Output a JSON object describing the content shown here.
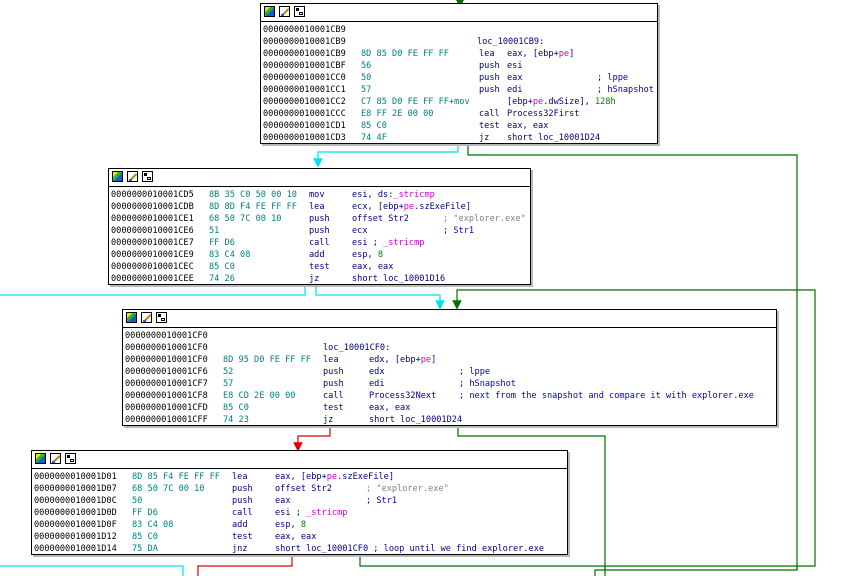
{
  "colors": {
    "flow_normal": "#00e0f0",
    "flow_taken": "#007000",
    "flow_not_taken": "#e00000",
    "address": "#000000",
    "bytes": "#008080",
    "instruction": "#000080",
    "symbol": "#d000d0",
    "string": "#808080",
    "number": "#008000"
  },
  "blocks": [
    {
      "id": "block-10001CB9",
      "header_icons": [
        "node-color-icon",
        "rename-node-icon",
        "graph-overview-icon"
      ],
      "lines": [
        {
          "addr": "0000000010001CB9"
        },
        {
          "addr": "0000000010001CB9",
          "label": "loc_10001CB9:"
        },
        {
          "addr": "0000000010001CB9",
          "bytes": "8D 85 D0 FE FF FF",
          "mnem": "lea",
          "ops": [
            {
              "t": "eax, [ebp+"
            },
            {
              "t": "pe",
              "k": "sym"
            },
            {
              "t": "]"
            }
          ]
        },
        {
          "addr": "0000000010001CBF",
          "bytes": "56",
          "mnem": "push",
          "ops": [
            {
              "t": "esi"
            }
          ]
        },
        {
          "addr": "0000000010001CC0",
          "bytes": "50",
          "mnem": "push",
          "ops": [
            {
              "t": "eax"
            }
          ],
          "comment": "; lppe"
        },
        {
          "addr": "0000000010001CC1",
          "bytes": "57",
          "mnem": "push",
          "ops": [
            {
              "t": "edi"
            }
          ],
          "comment": "; hSnapshot"
        },
        {
          "addr": "0000000010001CC2",
          "bytes": "C7 85 D0 FE FF FF+mov",
          "mnem": "",
          "ops": [
            {
              "t": "[ebp+"
            },
            {
              "t": "pe",
              "k": "sym"
            },
            {
              "t": ".dwSize], "
            },
            {
              "t": "128h",
              "k": "num"
            }
          ]
        },
        {
          "addr": "0000000010001CCC",
          "bytes": "E8 FF 2E 00 00",
          "mnem": "call",
          "ops": [
            {
              "t": "Process32First"
            }
          ]
        },
        {
          "addr": "0000000010001CD1",
          "bytes": "85 C0",
          "mnem": "test",
          "ops": [
            {
              "t": "eax, eax"
            }
          ]
        },
        {
          "addr": "0000000010001CD3",
          "bytes": "74 4F",
          "mnem": "jz",
          "ops": [
            {
              "t": "short loc_10001D24"
            }
          ]
        }
      ]
    },
    {
      "id": "block-10001CD5",
      "header_icons": [
        "node-color-icon",
        "rename-node-icon",
        "graph-overview-icon"
      ],
      "lines": [
        {
          "addr": "0000000010001CD5",
          "bytes": "8B 35 C0 50 00 10",
          "mnem": "mov",
          "ops": [
            {
              "t": "esi, ds:"
            },
            {
              "t": "_stricmp",
              "k": "sym"
            }
          ]
        },
        {
          "addr": "0000000010001CDB",
          "bytes": "8D 8D F4 FE FF FF",
          "mnem": "lea",
          "ops": [
            {
              "t": "ecx, [ebp+"
            },
            {
              "t": "pe",
              "k": "sym"
            },
            {
              "t": ".szExeFile]"
            }
          ]
        },
        {
          "addr": "0000000010001CE1",
          "bytes": "68 50 7C 00 10",
          "mnem": "push",
          "ops": [
            {
              "t": "offset Str2"
            }
          ],
          "comment": "; \"explorer.exe\"",
          "ck": "str"
        },
        {
          "addr": "0000000010001CE6",
          "bytes": "51",
          "mnem": "push",
          "ops": [
            {
              "t": "ecx"
            }
          ],
          "comment": "; Str1"
        },
        {
          "addr": "0000000010001CE7",
          "bytes": "FF D6",
          "mnem": "call",
          "ops": [
            {
              "t": "esi ; "
            },
            {
              "t": "_stricmp",
              "k": "sym"
            }
          ]
        },
        {
          "addr": "0000000010001CE9",
          "bytes": "83 C4 08",
          "mnem": "add",
          "ops": [
            {
              "t": "esp, "
            },
            {
              "t": "8",
              "k": "num"
            }
          ]
        },
        {
          "addr": "0000000010001CEC",
          "bytes": "85 C0",
          "mnem": "test",
          "ops": [
            {
              "t": "eax, eax"
            }
          ]
        },
        {
          "addr": "0000000010001CEE",
          "bytes": "74 26",
          "mnem": "jz",
          "ops": [
            {
              "t": "short loc_10001D16"
            }
          ]
        }
      ]
    },
    {
      "id": "block-10001CF0",
      "header_icons": [
        "node-color-icon",
        "rename-node-icon",
        "graph-overview-icon"
      ],
      "lines": [
        {
          "addr": "0000000010001CF0"
        },
        {
          "addr": "0000000010001CF0",
          "label": "loc_10001CF0:"
        },
        {
          "addr": "0000000010001CF0",
          "bytes": "8D 95 D0 FE FF FF",
          "mnem": "lea",
          "ops": [
            {
              "t": "edx, [ebp+"
            },
            {
              "t": "pe",
              "k": "sym"
            },
            {
              "t": "]"
            }
          ]
        },
        {
          "addr": "0000000010001CF6",
          "bytes": "52",
          "mnem": "push",
          "ops": [
            {
              "t": "edx"
            }
          ],
          "comment": "; lppe"
        },
        {
          "addr": "0000000010001CF7",
          "bytes": "57",
          "mnem": "push",
          "ops": [
            {
              "t": "edi"
            }
          ],
          "comment": "; hSnapshot"
        },
        {
          "addr": "0000000010001CF8",
          "bytes": "E8 CD 2E 00 00",
          "mnem": "call",
          "ops": [
            {
              "t": "Process32Next"
            }
          ],
          "comment": "; next from the snapshot and compare it with explorer.exe"
        },
        {
          "addr": "0000000010001CFD",
          "bytes": "85 C0",
          "mnem": "test",
          "ops": [
            {
              "t": "eax, eax"
            }
          ]
        },
        {
          "addr": "0000000010001CFF",
          "bytes": "74 23",
          "mnem": "jz",
          "ops": [
            {
              "t": "short loc_10001D24"
            }
          ]
        }
      ]
    },
    {
      "id": "block-10001D01",
      "header_icons": [
        "node-color-icon",
        "rename-node-icon",
        "graph-overview-icon"
      ],
      "lines": [
        {
          "addr": "0000000010001D01",
          "bytes": "8D 85 F4 FE FF FF",
          "mnem": "lea",
          "ops": [
            {
              "t": "eax, [ebp+"
            },
            {
              "t": "pe",
              "k": "sym"
            },
            {
              "t": ".szExeFile]"
            }
          ]
        },
        {
          "addr": "0000000010001D07",
          "bytes": "68 50 7C 00 10",
          "mnem": "push",
          "ops": [
            {
              "t": "offset Str2"
            }
          ],
          "comment": "; \"explorer.exe\"",
          "ck": "str"
        },
        {
          "addr": "0000000010001D0C",
          "bytes": "50",
          "mnem": "push",
          "ops": [
            {
              "t": "eax"
            }
          ],
          "comment": "; Str1"
        },
        {
          "addr": "0000000010001D0D",
          "bytes": "FF D6",
          "mnem": "call",
          "ops": [
            {
              "t": "esi ; "
            },
            {
              "t": "_stricmp",
              "k": "sym"
            }
          ]
        },
        {
          "addr": "0000000010001D0F",
          "bytes": "83 C4 08",
          "mnem": "add",
          "ops": [
            {
              "t": "esp, "
            },
            {
              "t": "8",
              "k": "num"
            }
          ]
        },
        {
          "addr": "0000000010001D12",
          "bytes": "85 C0",
          "mnem": "test",
          "ops": [
            {
              "t": "eax, eax"
            }
          ]
        },
        {
          "addr": "0000000010001D14",
          "bytes": "75 DA",
          "mnem": "jnz",
          "ops": [
            {
              "t": "short loc_10001CF0 ; loop until we find explorer.exe"
            }
          ]
        }
      ]
    }
  ]
}
